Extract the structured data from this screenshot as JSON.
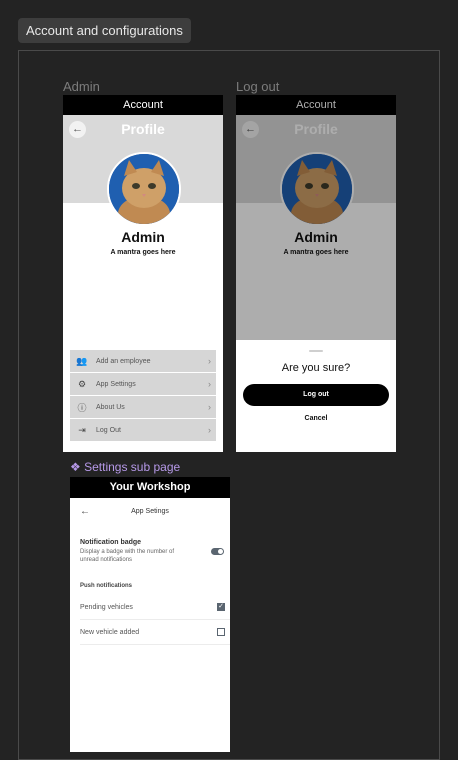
{
  "section": {
    "title": "Account and configurations"
  },
  "admin_frame": {
    "label": "Admin",
    "top_bar": "Account",
    "profile_title": "Profile",
    "name": "Admin",
    "mantra": "A mantra goes here",
    "menu": [
      {
        "label": "Add an employee",
        "icon": "add-user-icon"
      },
      {
        "label": "App Settings",
        "icon": "gear-icon"
      },
      {
        "label": "About Us",
        "icon": "info-icon"
      },
      {
        "label": "Log Out",
        "icon": "logout-icon"
      }
    ]
  },
  "logout_frame": {
    "label": "Log out",
    "top_bar": "Account",
    "profile_title": "Profile",
    "name": "Admin",
    "mantra": "A mantra goes here",
    "dialog": {
      "question": "Are you sure?",
      "confirm_label": "Log out",
      "cancel_label": "Cancel"
    }
  },
  "settings_frame": {
    "label": "❖ Settings sub page",
    "top_bar": "Your Workshop",
    "nav_title": "App Setings",
    "notification_badge": {
      "title": "Notification badge",
      "description": "Display a badge with the number of unread notifications",
      "enabled": true
    },
    "push_section": "Push notifications",
    "push_items": [
      {
        "label": "Pending vehicles",
        "checked": true
      },
      {
        "label": "New vehicle added",
        "checked": false
      }
    ]
  },
  "colors": {
    "canvas": "#232323",
    "accent_label": "#b699e8",
    "avatar_bg": "#1f5fb0"
  }
}
